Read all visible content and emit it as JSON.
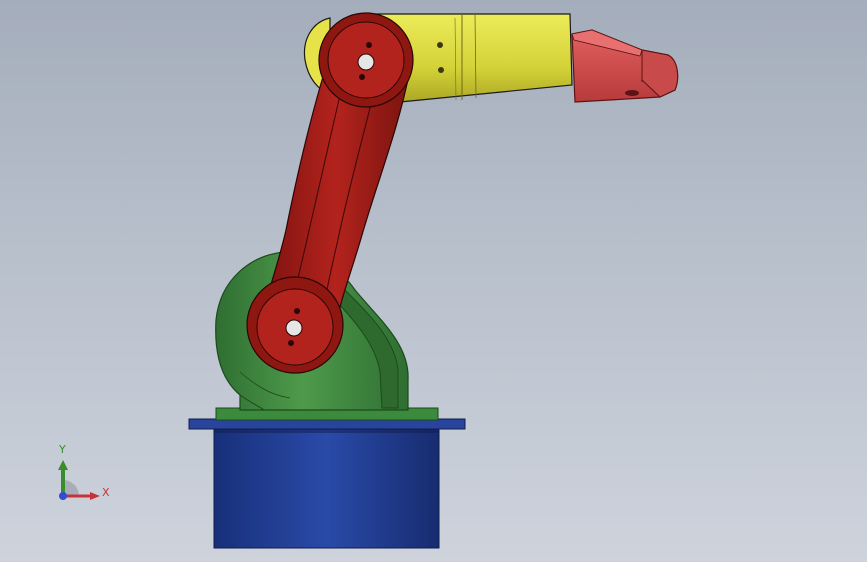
{
  "viewport": {
    "background_top": "#a4adbb",
    "background_bottom": "#ced3dc"
  },
  "model": {
    "name": "robot-arm-assembly",
    "colors": {
      "base": "#1f3a8f",
      "shoulder": "#3f8a3f",
      "upper_arm": "#9e1b16",
      "forearm": "#d6d63a",
      "gripper": "#cf4848",
      "edge": "#1a1a1a"
    }
  },
  "triad": {
    "x_label": "X",
    "y_label": "Y",
    "x_color": "#c8313a",
    "y_color": "#3a8c2e",
    "z_color": "#2f4fd0"
  }
}
